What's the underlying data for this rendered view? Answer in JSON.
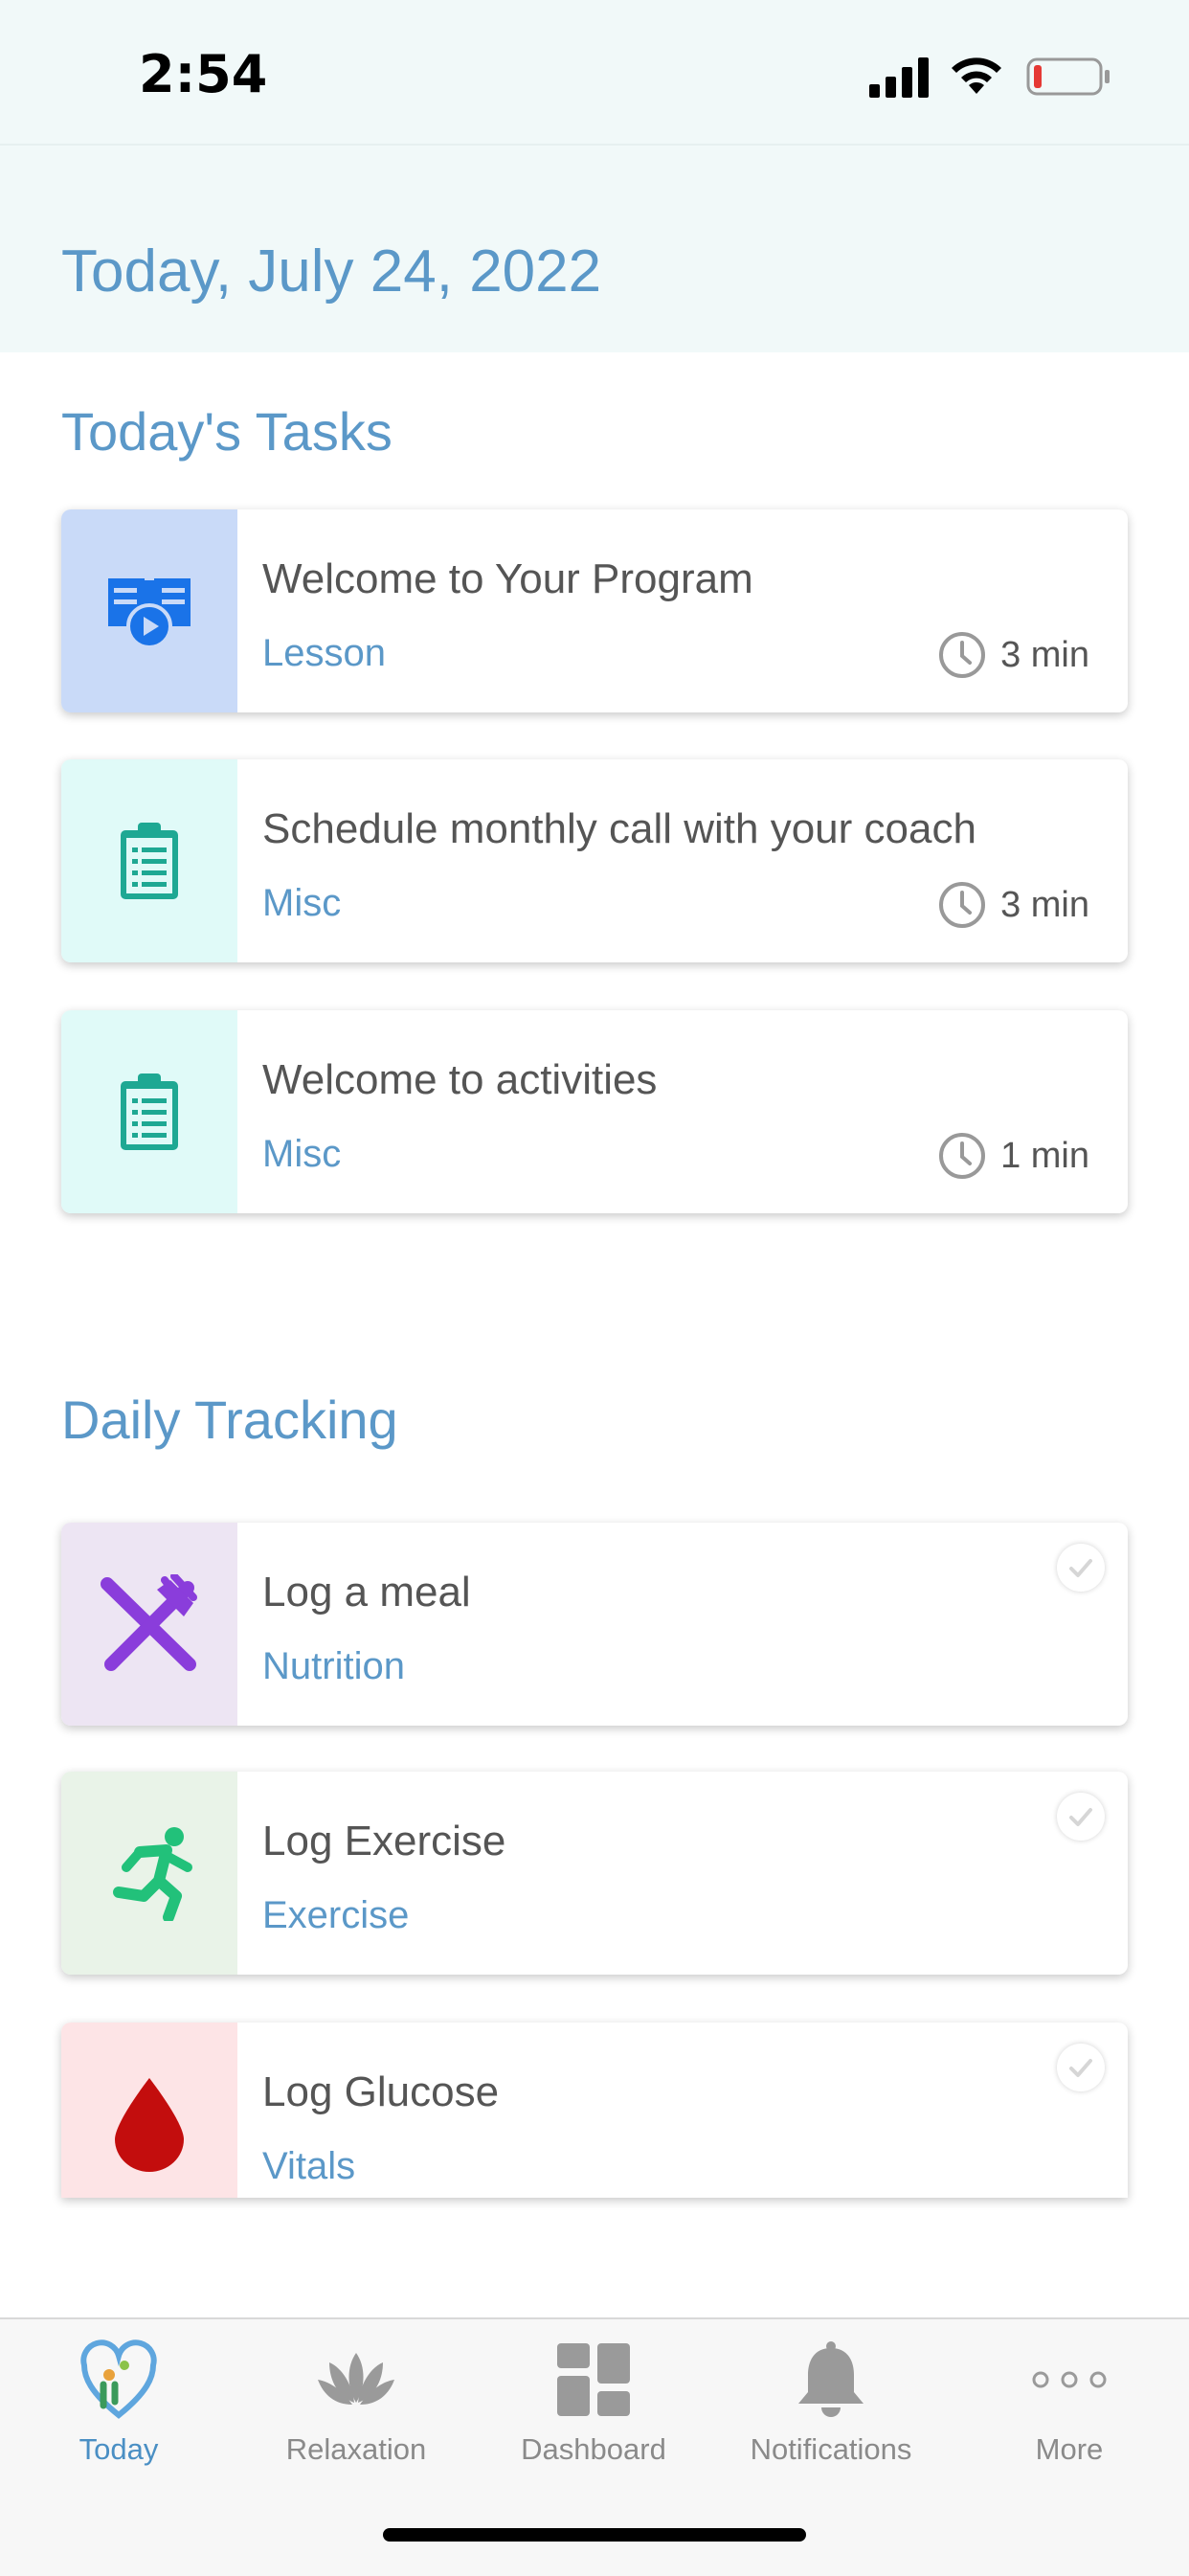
{
  "status": {
    "time": "2:54"
  },
  "header": {
    "date": "Today, July 24, 2022"
  },
  "tasks": {
    "title": "Today's Tasks",
    "items": [
      {
        "title": "Welcome to Your Program",
        "category": "Lesson",
        "duration": "3 min",
        "icon": "lesson-video-icon",
        "bg": "#c9daf8"
      },
      {
        "title": "Schedule monthly call with your coach",
        "category": "Misc",
        "duration": "3 min",
        "icon": "clipboard-icon",
        "bg": "#e0faf8"
      },
      {
        "title": "Welcome to activities",
        "category": "Misc",
        "duration": "1 min",
        "icon": "clipboard-icon",
        "bg": "#e0faf8"
      }
    ]
  },
  "tracking": {
    "title": "Daily Tracking",
    "items": [
      {
        "title": "Log a meal",
        "category": "Nutrition",
        "icon": "fork-knife-icon",
        "bg": "#ede5f3"
      },
      {
        "title": "Log Exercise",
        "category": "Exercise",
        "icon": "running-icon",
        "bg": "#e9f3e8"
      },
      {
        "title": "Log Glucose",
        "category": "Vitals",
        "icon": "blood-drop-icon",
        "bg": "#fde4e6"
      }
    ]
  },
  "tabbar": {
    "tabs": [
      {
        "label": "Today",
        "icon": "today-logo-icon",
        "active": true
      },
      {
        "label": "Relaxation",
        "icon": "lotus-icon",
        "active": false
      },
      {
        "label": "Dashboard",
        "icon": "dashboard-icon",
        "active": false
      },
      {
        "label": "Notifications",
        "icon": "bell-icon",
        "active": false
      },
      {
        "label": "More",
        "icon": "more-dots-icon",
        "active": false
      }
    ]
  },
  "colors": {
    "accent": "#5b98c8",
    "text": "#555555",
    "header_bg": "#f1f9f9"
  }
}
